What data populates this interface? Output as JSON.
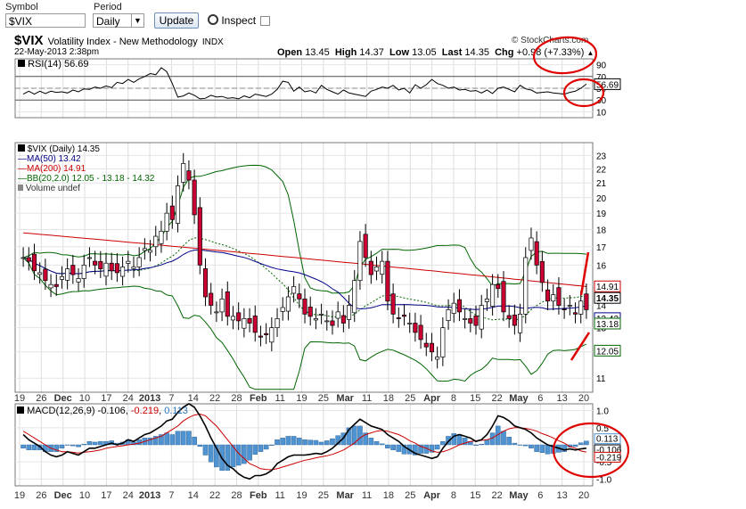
{
  "controls": {
    "symbol_label": "Symbol",
    "symbol_value": "$VIX",
    "period_label": "Period",
    "period_value": "Daily",
    "update_label": "Update",
    "inspect_label": "Inspect"
  },
  "header": {
    "symbol": "$VIX",
    "name": "Volatility Index - New Methodology",
    "exchange": "INDX",
    "brand": "© StockCharts.com",
    "date": "22-May-2013 2:38pm",
    "open_label": "Open",
    "open": "13.45",
    "high_label": "High",
    "high": "14.37",
    "low_label": "Low",
    "low": "13.05",
    "last_label": "Last",
    "last": "14.35",
    "chg_label": "Chg",
    "chg": "+0.98 (+7.33%)"
  },
  "colors": {
    "up_candle": "#ffffff",
    "down_candle": "#cc0033",
    "ma50": "#000088",
    "ma200": "#cc0000",
    "bb": "#006600",
    "macd_hist": "#4f93d0",
    "annotation": "#e00000"
  },
  "chart_data": [
    {
      "type": "line",
      "title": "RSI(14) 56.69",
      "ylim": [
        0,
        100
      ],
      "y_ticks": [
        "90",
        "70",
        "50",
        "30",
        "10"
      ],
      "guides": [
        30,
        70
      ],
      "last_value_label": "56.69",
      "values": [
        40,
        45,
        40,
        45,
        41,
        45,
        43,
        44,
        42,
        47,
        44,
        49,
        48,
        52,
        50,
        54,
        51,
        60,
        58,
        65,
        60,
        66,
        70,
        75,
        73,
        85,
        78,
        58,
        35,
        37,
        42,
        38,
        32,
        33,
        38,
        35,
        36,
        33,
        34,
        32,
        37,
        34,
        40,
        38,
        36,
        40,
        48,
        62,
        60,
        45,
        52,
        44,
        46,
        42,
        55,
        48,
        44,
        40,
        47,
        42,
        40,
        38,
        36,
        45,
        48,
        52,
        50,
        55,
        47,
        50,
        42,
        56,
        50,
        56,
        65,
        58,
        55,
        50,
        52,
        47,
        48,
        45,
        46,
        42,
        47,
        41,
        50,
        52,
        48,
        44,
        55,
        49,
        47,
        42,
        43,
        44,
        42,
        41,
        40,
        43,
        45,
        50,
        57
      ]
    },
    {
      "type": "candlestick",
      "title": "$VIX (Daily) 14.35",
      "legend": [
        "MA(50) 13.42",
        "MA(200) 14.91",
        "BB(20,2.0) 12.05 - 13.18 - 14.32",
        "Volume undef"
      ],
      "y_scale": "log",
      "ylim": [
        10.5,
        24
      ],
      "y_ticks": [
        "23",
        "22",
        "21",
        "20",
        "19",
        "18",
        "17",
        "16",
        "15",
        "14",
        "13",
        "12",
        "11"
      ],
      "price_labels": [
        "14.91",
        "14.35",
        "13.42",
        "13.18",
        "12.05"
      ],
      "x_labels": [
        "19",
        "26",
        "Dec",
        "10",
        "17",
        "24",
        "2013",
        "7",
        "14",
        "22",
        "28",
        "Feb",
        "11",
        "19",
        "25",
        "Mar",
        "11",
        "18",
        "25",
        "Apr",
        "8",
        "15",
        "22",
        "May",
        "6",
        "13",
        "20"
      ],
      "closes": [
        16.4,
        16.2,
        15.7,
        15.6,
        15.2,
        15.0,
        14.9,
        15.4,
        15.8,
        15.5,
        15.3,
        16.0,
        16.4,
        16.0,
        15.8,
        16.1,
        15.7,
        15.6,
        15.9,
        16.2,
        15.9,
        16.4,
        16.9,
        16.8,
        17.6,
        17.9,
        19.0,
        18.6,
        20.8,
        22.4,
        21.2,
        18.9,
        16.0,
        14.4,
        14.0,
        13.7,
        14.3,
        13.5,
        13.5,
        13.3,
        13.4,
        13.2,
        12.8,
        12.6,
        12.7,
        13.0,
        13.4,
        13.9,
        14.4,
        14.9,
        14.3,
        13.6,
        13.5,
        13.4,
        13.6,
        13.3,
        13.1,
        13.7,
        13.2,
        14.0,
        15.2,
        17.3,
        16.4,
        15.5,
        15.9,
        16.2,
        14.2,
        13.6,
        13.4,
        13.5,
        13.2,
        12.8,
        12.5,
        12.2,
        12.0,
        11.8,
        13.0,
        13.8,
        14.1,
        13.7,
        13.4,
        13.2,
        13.1,
        14.0,
        14.3,
        15.0,
        14.8,
        13.7,
        13.4,
        13.1,
        13.6,
        16.4,
        17.5,
        16.0,
        15.1,
        14.2,
        14.5,
        14.0,
        13.8,
        14.0,
        13.6,
        14.2,
        13.8
      ]
    },
    {
      "type": "line",
      "title": "MACD(12,26,9) -0.106, -0.219, 0.113",
      "legend": [
        "MACD(12,26,9)",
        "-0.106",
        "-0.219",
        "0.113"
      ],
      "ylim": [
        -1.2,
        1.2
      ],
      "y_ticks": [
        "1.0",
        "0.5",
        "-0.5",
        "-1.0"
      ],
      "value_labels": [
        "0.113",
        "-0.106",
        "-0.219"
      ],
      "macd": [
        0.3,
        0.15,
        0.05,
        -0.05,
        -0.2,
        -0.3,
        -0.35,
        -0.3,
        -0.2,
        -0.25,
        -0.3,
        -0.2,
        -0.1,
        -0.1,
        -0.05,
        0.0,
        0.05,
        0.0,
        0.05,
        0.15,
        0.1,
        0.2,
        0.3,
        0.35,
        0.45,
        0.55,
        0.7,
        0.75,
        0.95,
        1.1,
        1.2,
        1.1,
        0.85,
        0.55,
        0.2,
        -0.1,
        -0.4,
        -0.6,
        -0.7,
        -0.85,
        -0.95,
        -1.0,
        -0.9,
        -0.9,
        -0.85,
        -0.75,
        -0.55,
        -0.45,
        -0.35,
        -0.3,
        -0.3,
        -0.3,
        -0.28,
        -0.25,
        -0.27,
        -0.2,
        -0.1,
        0.05,
        0.2,
        0.45,
        0.6,
        0.75,
        0.65,
        0.55,
        0.5,
        0.45,
        0.3,
        0.2,
        0.1,
        -0.05,
        -0.15,
        -0.25,
        -0.3,
        -0.35,
        -0.4,
        -0.35,
        -0.1,
        0.1,
        0.25,
        0.3,
        0.25,
        0.2,
        0.1,
        0.15,
        0.3,
        0.55,
        0.85,
        0.8,
        0.7,
        0.55,
        0.5,
        0.45,
        0.35,
        0.2,
        0.1,
        0.0,
        -0.05,
        -0.1,
        -0.15,
        -0.12,
        -0.15,
        -0.12,
        -0.1
      ],
      "signal": [
        0.4,
        0.3,
        0.2,
        0.1,
        0.0,
        -0.1,
        -0.15,
        -0.2,
        -0.2,
        -0.22,
        -0.24,
        -0.22,
        -0.2,
        -0.18,
        -0.15,
        -0.1,
        -0.07,
        -0.05,
        -0.03,
        0.0,
        0.02,
        0.05,
        0.1,
        0.15,
        0.2,
        0.25,
        0.35,
        0.45,
        0.55,
        0.7,
        0.8,
        0.87,
        0.9,
        0.85,
        0.7,
        0.55,
        0.35,
        0.15,
        -0.05,
        -0.25,
        -0.4,
        -0.55,
        -0.62,
        -0.7,
        -0.72,
        -0.73,
        -0.7,
        -0.65,
        -0.6,
        -0.55,
        -0.5,
        -0.45,
        -0.42,
        -0.38,
        -0.35,
        -0.32,
        -0.28,
        -0.22,
        -0.15,
        -0.05,
        0.05,
        0.2,
        0.3,
        0.35,
        0.4,
        0.42,
        0.4,
        0.35,
        0.3,
        0.22,
        0.12,
        0.05,
        -0.05,
        -0.1,
        -0.18,
        -0.22,
        -0.2,
        -0.15,
        -0.08,
        0.0,
        0.05,
        0.1,
        0.12,
        0.13,
        0.15,
        0.2,
        0.3,
        0.4,
        0.47,
        0.5,
        0.5,
        0.48,
        0.45,
        0.4,
        0.33,
        0.27,
        0.2,
        0.12,
        0.05,
        -0.05,
        -0.1,
        -0.18,
        -0.21
      ],
      "histogram": [
        -0.1,
        -0.15,
        -0.15,
        -0.15,
        -0.2,
        -0.2,
        -0.2,
        -0.1,
        0.0,
        -0.03,
        -0.06,
        0.02,
        0.1,
        0.08,
        0.1,
        0.1,
        0.12,
        0.05,
        0.08,
        0.15,
        0.08,
        0.15,
        0.2,
        0.2,
        0.25,
        0.3,
        0.35,
        0.3,
        0.4,
        0.4,
        0.4,
        0.23,
        -0.05,
        -0.3,
        -0.5,
        -0.65,
        -0.75,
        -0.75,
        -0.65,
        -0.6,
        -0.55,
        -0.45,
        -0.28,
        -0.2,
        -0.13,
        -0.02,
        0.15,
        0.2,
        0.25,
        0.25,
        0.2,
        0.15,
        0.14,
        0.13,
        0.08,
        0.12,
        0.18,
        0.27,
        0.35,
        0.5,
        0.55,
        0.55,
        0.35,
        0.2,
        0.1,
        0.03,
        -0.1,
        -0.15,
        -0.2,
        -0.27,
        -0.27,
        -0.3,
        -0.25,
        -0.25,
        -0.22,
        -0.13,
        0.1,
        0.25,
        0.33,
        0.3,
        0.2,
        0.1,
        -0.02,
        0.02,
        0.15,
        0.35,
        0.55,
        0.4,
        0.23,
        0.05,
        0.0,
        -0.03,
        -0.1,
        -0.2,
        -0.23,
        -0.27,
        -0.25,
        -0.22,
        -0.2,
        -0.07,
        -0.05,
        0.06,
        0.11
      ]
    }
  ]
}
